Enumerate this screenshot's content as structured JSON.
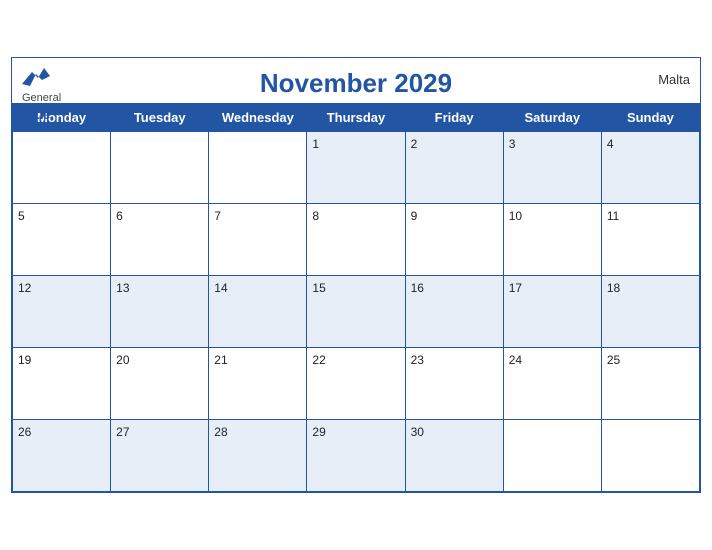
{
  "header": {
    "brand_general": "General",
    "brand_blue": "Blue",
    "title": "November 2029",
    "country": "Malta"
  },
  "weekdays": [
    "Monday",
    "Tuesday",
    "Wednesday",
    "Thursday",
    "Friday",
    "Saturday",
    "Sunday"
  ],
  "weeks": [
    [
      null,
      null,
      null,
      1,
      2,
      3,
      4
    ],
    [
      5,
      6,
      7,
      8,
      9,
      10,
      11
    ],
    [
      12,
      13,
      14,
      15,
      16,
      17,
      18
    ],
    [
      19,
      20,
      21,
      22,
      23,
      24,
      25
    ],
    [
      26,
      27,
      28,
      29,
      30,
      null,
      null
    ]
  ]
}
